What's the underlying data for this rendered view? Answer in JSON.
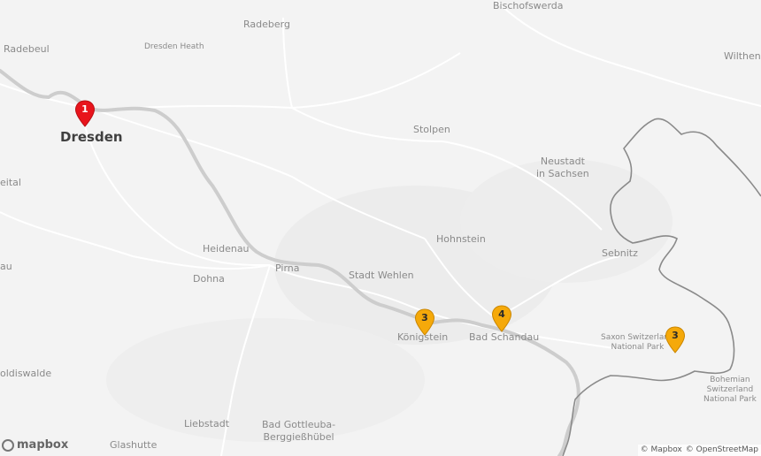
{
  "map": {
    "colors": {
      "land": "#f3f3f3",
      "river": "#cfcfcf",
      "road": "#ffffff",
      "border": "#8c8c8c",
      "red_marker": "#e8141c",
      "orange_marker": "#f5a90a"
    },
    "places": {
      "radebeul": "Radebeul",
      "radeberg": "Radeberg",
      "bischofswerda": "Bischofswerda",
      "wilthen": "Wilthen",
      "dresden_heath": "Dresden Heath",
      "dresden": "Dresden",
      "stolpen": "Stolpen",
      "neustadt": "Neustadt\nin Sachsen",
      "tal": "eital",
      "hohnstein": "Hohnstein",
      "sebnitz": "Sebnitz",
      "heidenau": "Heidenau",
      "pirna": "Pirna",
      "stadt_wehlen": "Stadt Wehlen",
      "dohna": "Dohna",
      "au": "au",
      "koenigstein": "Königstein",
      "bad_schandau": "Bad Schandau",
      "saxon_switzerland": "Saxon Switzerland\nNational Park",
      "bohemian_switzerland": "Bohemian\nSwitzerland\nNational Park",
      "dippoldiswalde": "oldiswalde",
      "liebstadt": "Liebstadt",
      "bad_gottleuba": "Bad Gottleuba-\nBerggießhübel",
      "glashutte": "Glashutte"
    },
    "markers": [
      {
        "count": "1",
        "color": "red"
      },
      {
        "count": "3",
        "color": "orange"
      },
      {
        "count": "4",
        "color": "orange"
      },
      {
        "count": "3",
        "color": "orange"
      }
    ],
    "logo_text": "mapbox",
    "attribution": [
      "© Mapbox",
      "© OpenStreetMap"
    ]
  }
}
